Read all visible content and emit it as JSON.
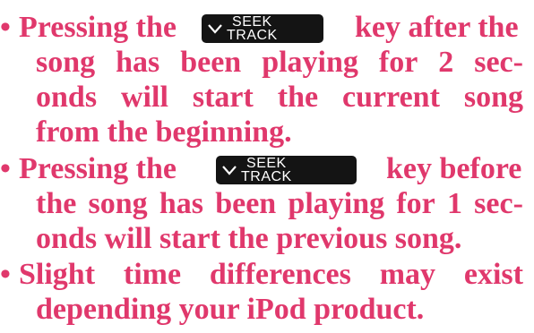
{
  "colors": {
    "text": "#e0386c",
    "key_bg": "#141414",
    "key_text": "#ffffff"
  },
  "bullet_symbol": "•",
  "key": {
    "icon": "chevron-down-icon",
    "top_label": "SEEK",
    "bottom_label": "TRACK"
  },
  "items": [
    {
      "before_key": "Pressing the",
      "after_key": "key after the",
      "continuation": [
        [
          "song",
          "has",
          "been",
          "playing",
          "for",
          "2",
          "sec-"
        ],
        [
          "onds",
          "will",
          "start",
          "the",
          "current",
          "song"
        ]
      ],
      "last_line": "from the beginning."
    },
    {
      "before_key": "Pressing the",
      "after_key": "key before",
      "continuation": [
        [
          "the",
          "song",
          "has",
          "been",
          "playing",
          "for",
          "1",
          "sec-"
        ]
      ],
      "last_line": "onds will start the previous song."
    },
    {
      "first_line_words": [
        "Slight",
        "time",
        "differences",
        "may",
        "exist"
      ],
      "last_line": "depending your iPod product."
    }
  ]
}
